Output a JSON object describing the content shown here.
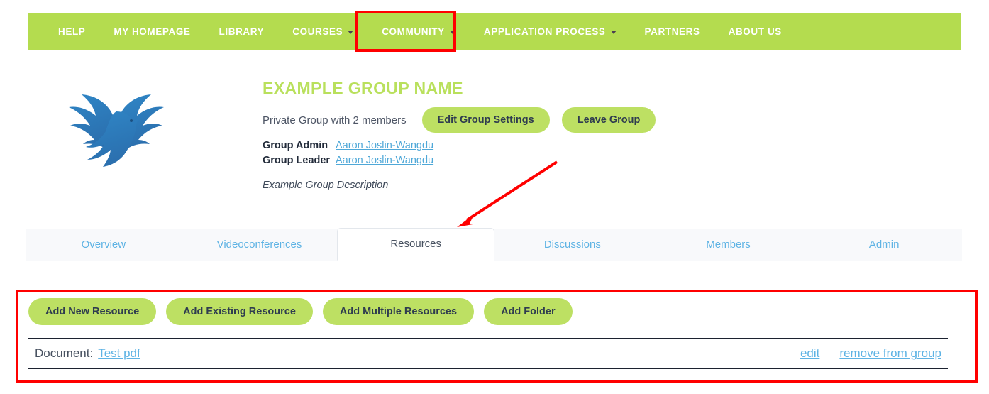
{
  "nav": {
    "items": [
      {
        "label": "HELP",
        "has_caret": false
      },
      {
        "label": "MY HOMEPAGE",
        "has_caret": false
      },
      {
        "label": "LIBRARY",
        "has_caret": false
      },
      {
        "label": "COURSES",
        "has_caret": true
      },
      {
        "label": "COMMUNITY",
        "has_caret": true
      },
      {
        "label": "APPLICATION PROCESS",
        "has_caret": true
      },
      {
        "label": "PARTNERS",
        "has_caret": false
      },
      {
        "label": "ABOUT US",
        "has_caret": false
      }
    ],
    "background_color": "#b4dc4f",
    "text_color": "#ffffff"
  },
  "group": {
    "logo_icon": "bird-logo-icon",
    "title": "EXAMPLE GROUP NAME",
    "title_color": "#b9e05c",
    "membership_text": "Private Group with 2 members",
    "edit_settings_label": "Edit Group Settings",
    "leave_group_label": "Leave Group",
    "admin_label": "Group Admin",
    "admin_name": "Aaron Joslin-Wangdu",
    "leader_label": "Group Leader",
    "leader_name": "Aaron Joslin-Wangdu",
    "description": "Example Group Description"
  },
  "tabs": [
    {
      "label": "Overview",
      "active": false
    },
    {
      "label": "Videoconferences",
      "active": false
    },
    {
      "label": "Resources",
      "active": true
    },
    {
      "label": "Discussions",
      "active": false
    },
    {
      "label": "Members",
      "active": false
    },
    {
      "label": "Admin",
      "active": false
    }
  ],
  "resources": {
    "buttons": [
      "Add New Resource",
      "Add Existing Resource",
      "Add Multiple Resources",
      "Add Folder"
    ],
    "button_color": "#bde063",
    "rows": [
      {
        "type_label": "Document:",
        "name": "Test pdf",
        "actions": [
          "edit",
          "remove from group"
        ]
      }
    ]
  },
  "annotations": {
    "highlight_color": "#ff0000",
    "nav_highlight_target": "COMMUNITY",
    "panel_highlight_target": "resources-panel",
    "arrow_target": "Resources tab"
  }
}
